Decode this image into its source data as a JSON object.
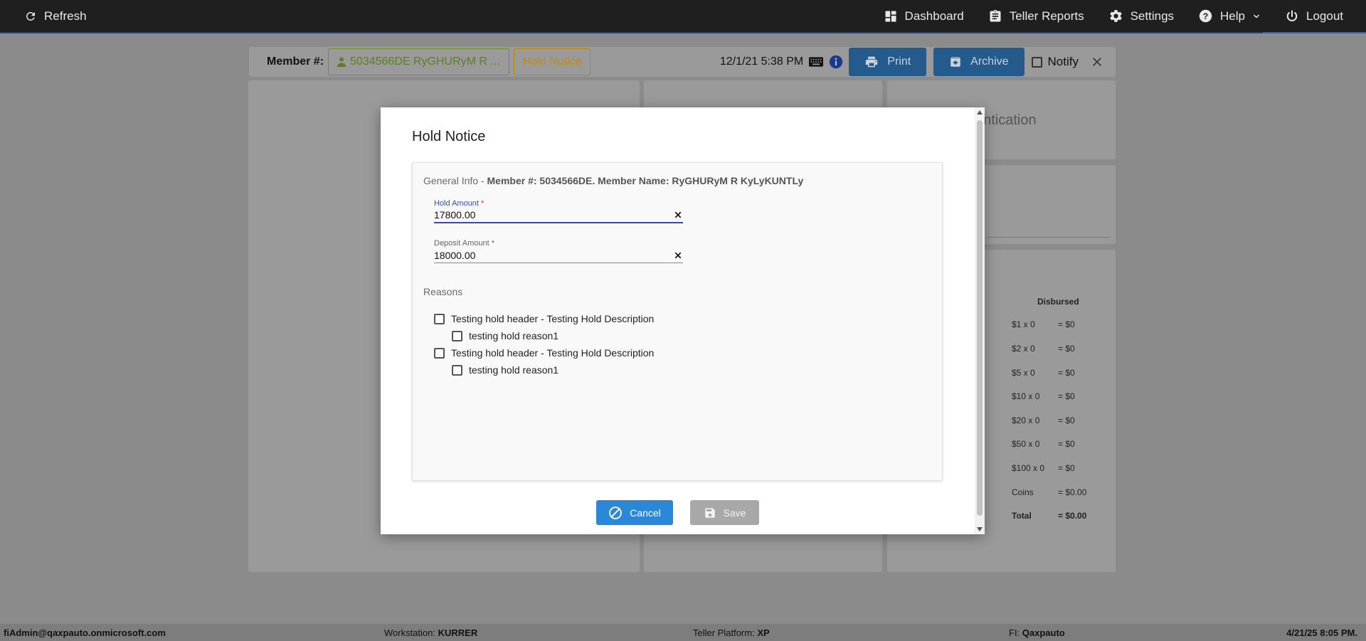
{
  "topbar": {
    "refresh_label": "Refresh",
    "nav": [
      {
        "label": "Dashboard",
        "icon": "dashboard-icon"
      },
      {
        "label": "Teller Reports",
        "icon": "clipboard-icon"
      },
      {
        "label": "Settings",
        "icon": "gear-icon"
      },
      {
        "label": "Help",
        "icon": "help-icon"
      },
      {
        "label": "Logout",
        "icon": "power-icon"
      }
    ]
  },
  "member_bar": {
    "label": "Member #:",
    "member_chip": "5034566DE RyGHURyM R ...",
    "hold_chip": "Hold Notice",
    "datetime": "12/1/21 5:38 PM",
    "print_label": "Print",
    "archive_label": "Archive",
    "notify_label": "Notify"
  },
  "background_panels": {
    "auth_title": "entication",
    "cash": {
      "header": "Disbursed",
      "rows": [
        {
          "denom": "$1 x 0",
          "amount": "= $0"
        },
        {
          "denom": "$2 x 0",
          "amount": "= $0"
        },
        {
          "denom": "$5 x 0",
          "amount": "= $0"
        },
        {
          "denom": "$10 x 0",
          "amount": "= $0"
        },
        {
          "denom": "$20 x 0",
          "amount": "= $0"
        },
        {
          "denom": "$50 x 0",
          "amount": "= $0"
        },
        {
          "denom": "$100 x 0",
          "amount": "= $0"
        },
        {
          "denom": "Coins",
          "amount": "= $0.00"
        },
        {
          "denom": "Total",
          "amount": "= $0.00"
        }
      ]
    }
  },
  "modal": {
    "title": "Hold Notice",
    "general_info_prefix": "General Info - ",
    "general_info_detail": "Member #: 5034566DE. Member Name: RyGHURyM R KyLyKUNTLy",
    "hold_amount": {
      "label": "Hold Amount",
      "required": "*",
      "value": "17800.00"
    },
    "deposit_amount": {
      "label": "Deposit Amount",
      "required": "*",
      "value": "18000.00"
    },
    "reasons_title": "Reasons",
    "reasons": [
      {
        "label": "Testing hold header - Testing Hold Description",
        "level": 0
      },
      {
        "label": "testing hold reason1",
        "level": 1
      },
      {
        "label": "Testing hold header - Testing Hold Description",
        "level": 0
      },
      {
        "label": "testing hold reason1",
        "level": 1
      }
    ],
    "cancel_label": "Cancel",
    "save_label": "Save"
  },
  "footer": {
    "user": "fiAdmin@qaxpauto.onmicrosoft.com",
    "workstation_label": "Workstation: ",
    "workstation": "KURRER",
    "platform_label": "Teller Platform: ",
    "platform": "XP",
    "fi_label": "FI: ",
    "fi": "Qaxpauto",
    "datetime": "4/21/25 8:05 PM."
  },
  "colors": {
    "topbar_bg": "#1f1f1f",
    "accent_blue": "#2b88d8",
    "active_field": "#3849b8",
    "member_chip": "#5d7f25",
    "hold_chip": "#c08a1a"
  }
}
